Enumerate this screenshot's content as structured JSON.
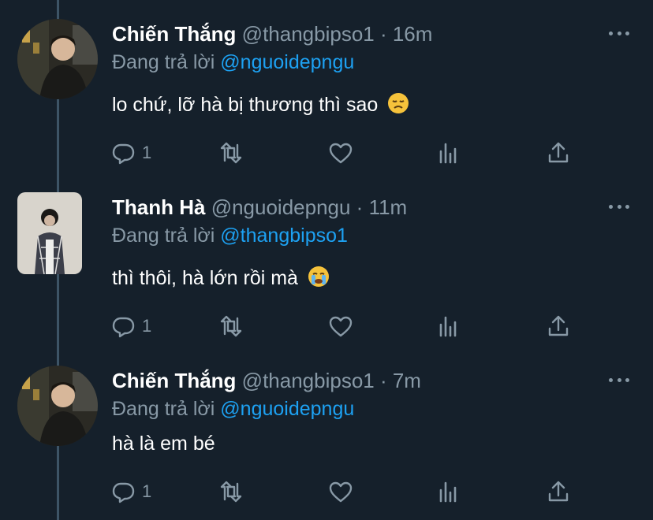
{
  "tweets": [
    {
      "name": "Chiến Thắng",
      "handle": "@thangbipso1 · 16m",
      "reply_prefix": "Đang trả lời",
      "reply_to": "@nguoidepngu",
      "text": "lo chứ, lỡ hà bị thương thì sao",
      "emoji": "disappointed-face",
      "reply_count": "1",
      "avatar": "man-portrait"
    },
    {
      "name": "Thanh Hà",
      "handle": "@nguoidepngu · 11m",
      "reply_prefix": "Đang trả lời",
      "reply_to": "@thangbipso1",
      "text": "thì thôi, hà lớn rồi mà",
      "emoji": "crying-face",
      "reply_count": "1",
      "avatar": "girl-portrait"
    },
    {
      "name": "Chiến Thắng",
      "handle": "@thangbipso1 · 7m",
      "reply_prefix": "Đang trả lời",
      "reply_to": "@nguoidepngu",
      "text": "hà là em bé",
      "emoji": "",
      "reply_count": "1",
      "avatar": "man-portrait"
    }
  ],
  "colors": {
    "background": "#15202b",
    "secondary_text": "#8899a6",
    "link": "#1da1f2"
  },
  "icons": [
    "reply-icon",
    "retweet-icon",
    "like-icon",
    "analytics-icon",
    "share-icon",
    "more-icon"
  ]
}
